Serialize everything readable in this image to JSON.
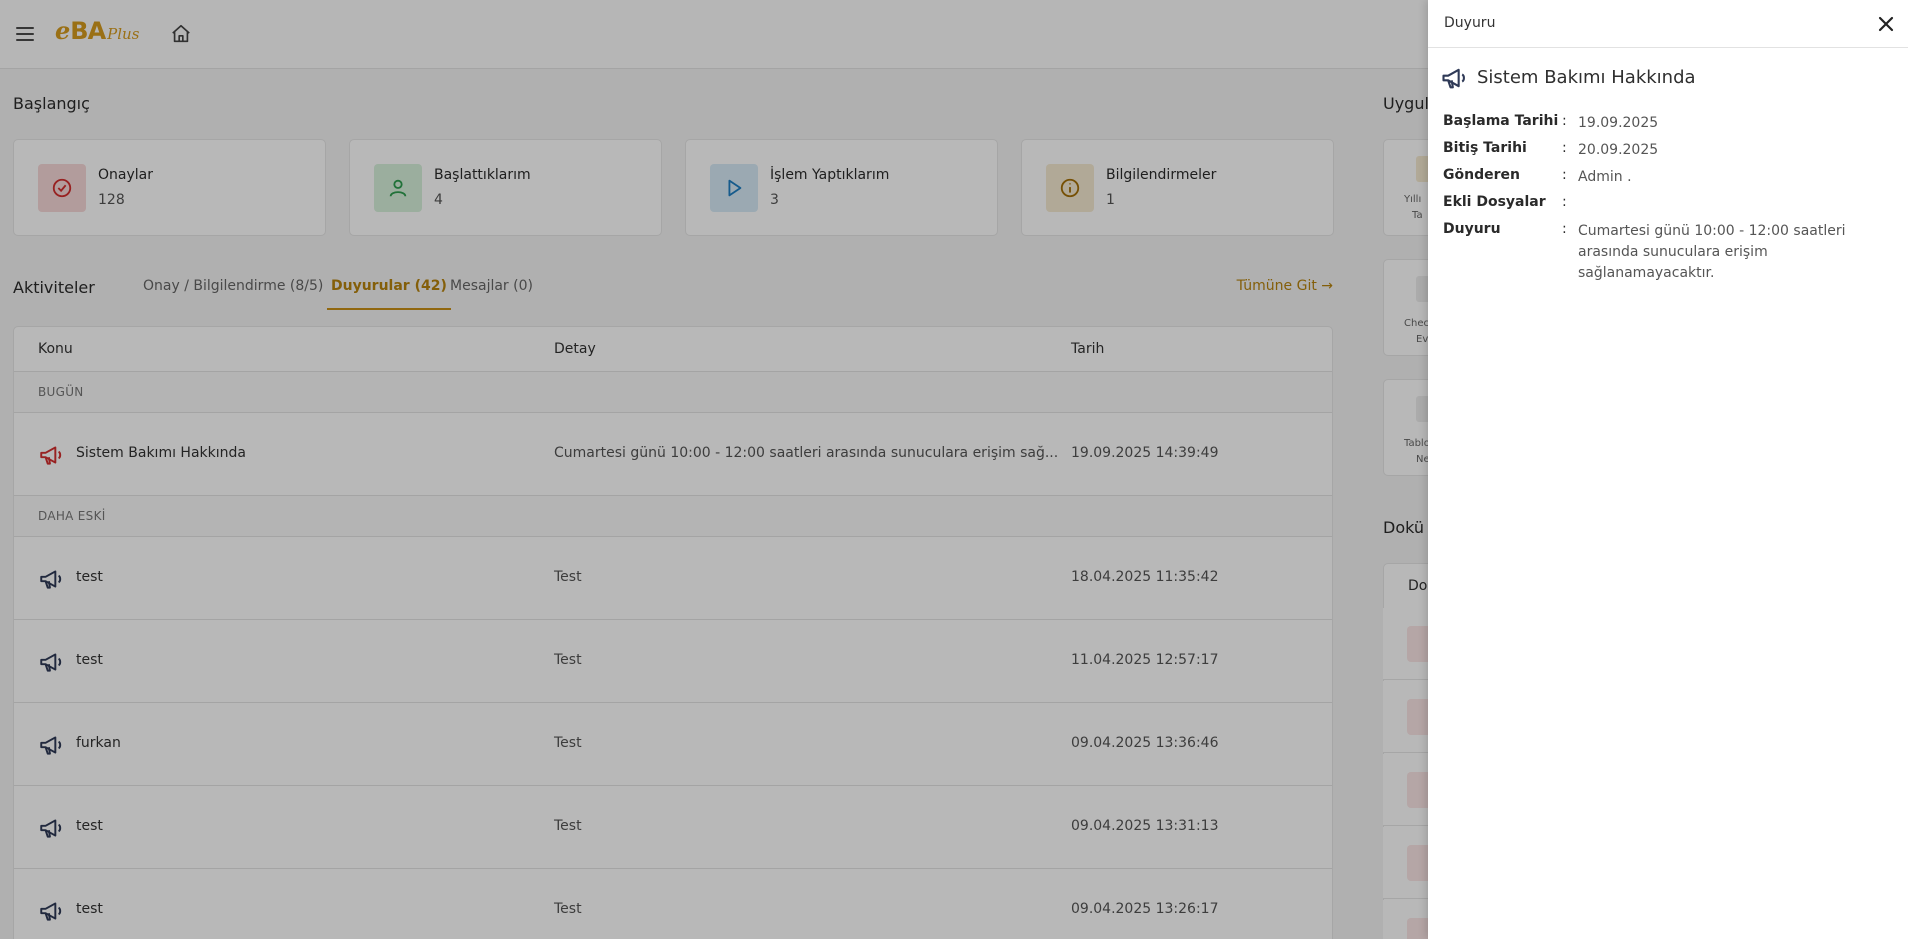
{
  "app": {
    "logo_e": "e",
    "logo_ba": "BA",
    "logo_plus": "Plus"
  },
  "start": {
    "title": "Başlangıç",
    "cards": [
      {
        "label": "Onaylar",
        "value": "128",
        "color": "#f7d9d9",
        "icon": "check-circle-icon"
      },
      {
        "label": "Başlattıklarım",
        "value": "4",
        "color": "#d7f1dc",
        "icon": "user-icon"
      },
      {
        "label": "İşlem Yaptıklarım",
        "value": "3",
        "color": "#d7ebf7",
        "icon": "play-icon"
      },
      {
        "label": "Bilgilendirmeler",
        "value": "1",
        "color": "#f6ead1",
        "icon": "info-circle-icon"
      }
    ]
  },
  "activities": {
    "title": "Aktiviteler",
    "tabs": [
      {
        "label": "Onay / Bilgilendirme (8/5)"
      },
      {
        "label": "Duyurular (42)"
      },
      {
        "label": "Mesajlar (0)"
      }
    ],
    "goto": "Tümüne Git →",
    "columns": {
      "subject": "Konu",
      "detail": "Detay",
      "date": "Tarih"
    },
    "group_today": "BUGÜN",
    "group_older": "DAHA ESKİ",
    "rows_today": [
      {
        "subject": "Sistem Bakımı Hakkında",
        "detail": "Cumartesi günü 10:00 - 12:00 saatleri arasında sunuculara erişim sağ...",
        "date": "19.09.2025 14:39:49"
      }
    ],
    "rows_older": [
      {
        "subject": "test",
        "detail": "Test",
        "date": "18.04.2025 11:35:42"
      },
      {
        "subject": "test",
        "detail": "Test",
        "date": "11.04.2025 12:57:17"
      },
      {
        "subject": "furkan",
        "detail": "Test",
        "date": "09.04.2025 13:36:46"
      },
      {
        "subject": "test",
        "detail": "Test",
        "date": "09.04.2025 13:31:13"
      },
      {
        "subject": "test",
        "detail": "Test",
        "date": "09.04.2025 13:26:17"
      }
    ]
  },
  "right_panel": {
    "apps_title": "Uygula",
    "app_tiles": [
      {
        "line1": "Yıllı",
        "line2": "Ta"
      },
      {
        "line1": "Chec",
        "line2": "Ev"
      },
      {
        "line1": "Tablo",
        "line2": "Ne"
      }
    ],
    "docs_title": "Dokü",
    "docs_header": "Dok"
  },
  "drawer": {
    "title": "Duyuru",
    "announcement_title": "Sistem Bakımı Hakkında",
    "colon": ":",
    "fields": [
      {
        "key": "Başlama Tarihi",
        "value": "19.09.2025"
      },
      {
        "key": "Bitiş Tarihi",
        "value": "20.09.2025"
      },
      {
        "key": "Gönderen",
        "value": "Admin ."
      },
      {
        "key": "Ekli Dosyalar",
        "value": ""
      },
      {
        "key": "Duyuru",
        "value": "Cumartesi günü 10:00 - 12:00 saatleri arasında sunuculara erişim sağlanamayacaktır."
      }
    ]
  },
  "colors": {
    "accent": "#c99117",
    "announce_icon_red": "#d32f2f",
    "announce_icon_navy": "#2f3a57"
  }
}
